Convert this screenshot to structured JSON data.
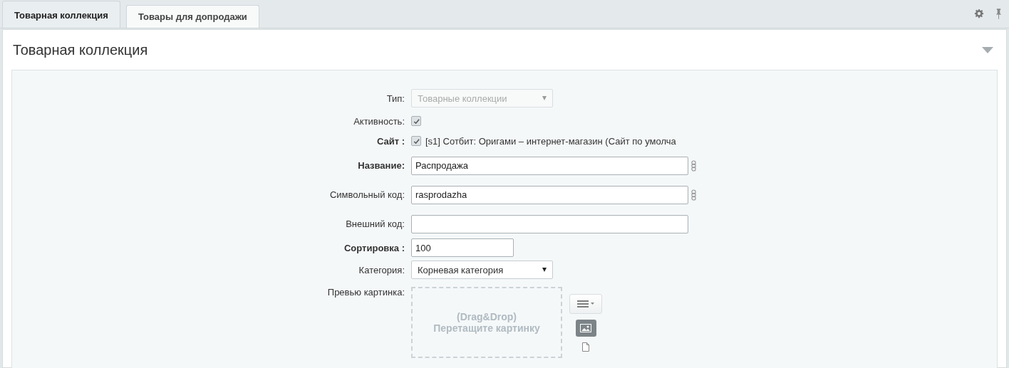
{
  "tabs": [
    {
      "label": "Товарная коллекция",
      "selected": true
    },
    {
      "label": "Товары для допродажи",
      "selected": false
    }
  ],
  "section": {
    "title": "Товарная коллекция",
    "expanded": true
  },
  "fields": [
    {
      "kind": "select",
      "label": "Тип:",
      "required": false,
      "value": "Товарные коллекции",
      "disabled": true
    },
    {
      "kind": "checkbox",
      "label": "Активность:",
      "required": false,
      "checked": true
    },
    {
      "kind": "checkbox",
      "label": "Сайт :",
      "required": true,
      "checked": true,
      "text": "[s1] Сотбит: Оригами – интернет-магазин (Сайт по умолча"
    },
    {
      "kind": "text",
      "label": "Название:",
      "required": true,
      "value": "Распродажа",
      "linked": true
    },
    {
      "kind": "text",
      "label": "Символьный код:",
      "required": false,
      "value": "rasprodazha",
      "linked": true
    },
    {
      "kind": "text",
      "label": "Внешний код:",
      "required": false
    },
    {
      "kind": "short-text",
      "label": "Сортировка :",
      "required": true,
      "value": "100"
    },
    {
      "kind": "select",
      "label": "Категория:",
      "required": false,
      "value": "Корневая категория",
      "disabled": false
    },
    {
      "kind": "image",
      "label": "Превью картинка:",
      "required": false,
      "drop_lines": [
        "(Drag&Drop)",
        "Перетащите картинку"
      ]
    }
  ]
}
